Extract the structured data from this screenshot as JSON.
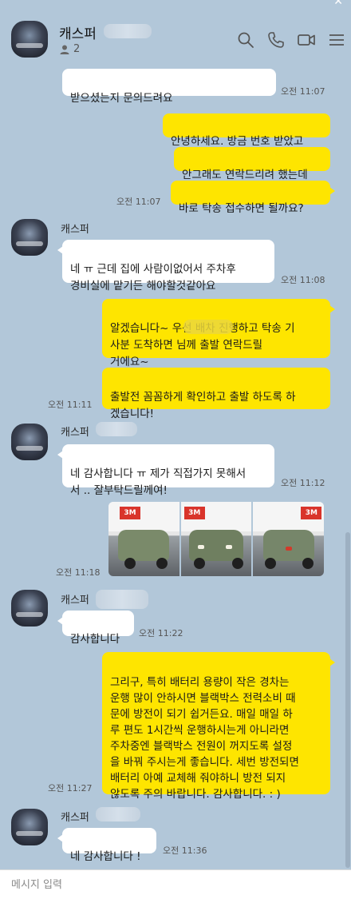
{
  "header": {
    "name": "캐스퍼",
    "member_count": "2",
    "close_glyph": "✕",
    "icons": [
      "search-icon",
      "phone-icon",
      "video-call-icon",
      "menu-icon"
    ]
  },
  "messages": [
    {
      "text": "받으셨는지 문의드려요",
      "time": "오전 11:07"
    },
    {
      "text": "안녕하세요. 방금 번호 받았고"
    },
    {
      "text": "안그래도 연락드리려 했는데"
    },
    {
      "text": "바로 탁송 접수하면 될까요?",
      "time": "오전 11:07"
    },
    {
      "sender": "캐스퍼",
      "text": "네 ㅠ 근데 집에 사람이없어서 주차후\n경비실에 맡기든 해야할것같아요",
      "time": "오전 11:08"
    },
    {
      "text": "알겠습니다~ 우선 배차 진행하고 탁송 기\n사분 도착하면       님께 출발 연락드릴\n거에요~"
    },
    {
      "text": "출발전 꼼꼼하게 확인하고 출발 하도록 하\n겠습니다!",
      "time": "오전 11:11"
    },
    {
      "sender": "캐스퍼",
      "text": "네 감사합니다 ㅠ 제가 직접가지 못해서\n서 .. 잘부탁드릴께여!",
      "time": "오전 11:12"
    },
    {
      "photo_signs": [
        "3M",
        "3M",
        "3M"
      ],
      "time": "오전 11:18"
    },
    {
      "sender": "캐스퍼",
      "text": "감사합니다",
      "time": "오전 11:22"
    },
    {
      "text": "그리구, 특히 배터리 용량이 작은 경차는\n운행 많이 안하시면 블랙박스 전력소비 때\n문에 방전이 되기 쉽거든요. 매일 매일 하\n루 편도 1시간씩 운행하시는게 아니라면\n주차중엔 블랙박스 전원이 꺼지도록 설정\n을 바꿔 주시는게 좋습니다. 세번 방전되면\n배터리 아예 교체해 줘야하니 방전 되지\n않도록 주의 바랍니다. 감사합니다. : )",
      "time": "오전 11:27"
    },
    {
      "sender": "캐스퍼",
      "text": "네 감사합니다 !",
      "time": "오전 11:36"
    }
  ],
  "input": {
    "placeholder": "메시지 입력"
  },
  "colors": {
    "background": "#b2c7d9",
    "outgoing": "#fee500",
    "incoming": "#ffffff"
  }
}
